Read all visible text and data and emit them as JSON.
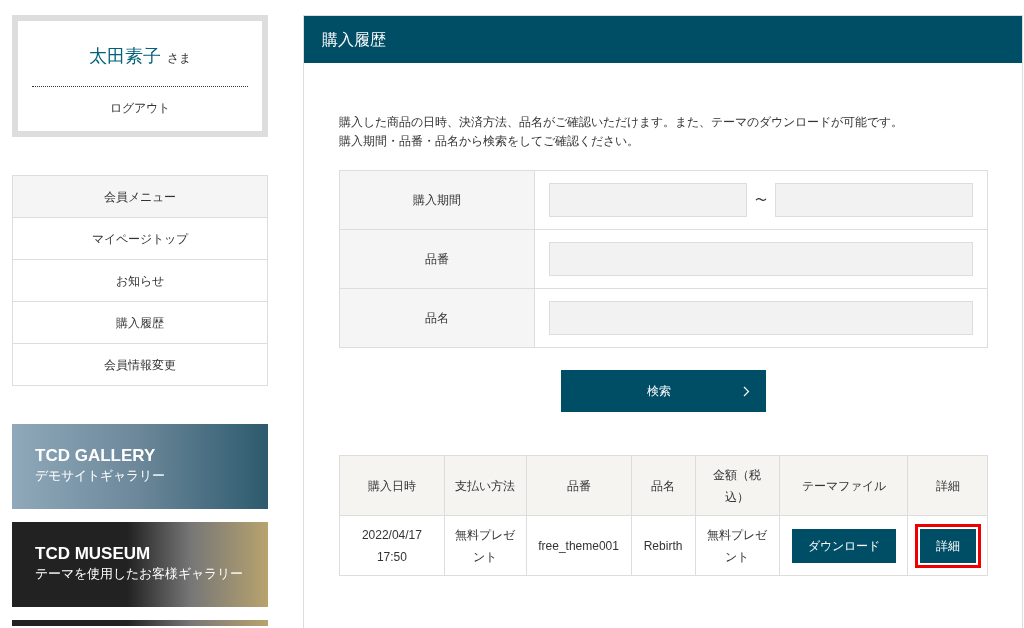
{
  "user_box": {
    "name": "太田素子",
    "honorific": "さま",
    "logout": "ログアウト"
  },
  "member_menu": {
    "heading": "会員メニュー",
    "items": [
      {
        "label": "マイページトップ"
      },
      {
        "label": "お知らせ"
      },
      {
        "label": "購入履歴"
      },
      {
        "label": "会員情報変更"
      }
    ]
  },
  "banners": [
    {
      "title": "TCD GALLERY",
      "subtitle": "デモサイトギャラリー",
      "kind": "light"
    },
    {
      "title": "TCD MUSEUM",
      "subtitle": "テーマを使用したお客様ギャラリー",
      "kind": "dark"
    },
    {
      "kind": "dark"
    }
  ],
  "panel": {
    "title": "購入履歴",
    "intro": [
      "購入した商品の日時、決済方法、品名がご確認いただけます。また、テーマのダウンロードが可能です。",
      "購入期間・品番・品名から検索をしてご確認ください。"
    ],
    "search_form": [
      {
        "label": "購入期間",
        "kind": "range",
        "separator": "〜"
      },
      {
        "label": "品番",
        "kind": "text"
      },
      {
        "label": "品名",
        "kind": "text"
      }
    ],
    "search_button": "検索",
    "results": {
      "columns": [
        "購入日時",
        "支払い方法",
        "品番",
        "品名",
        "金額（税込）",
        "テーマファイル",
        "詳細"
      ],
      "rows": [
        {
          "date": "2022/04/17 17:50",
          "payment": "無料プレゼント",
          "code": "free_theme001",
          "name": "Rebirth",
          "price": "無料プレゼント",
          "download": "ダウンロード",
          "detail": "詳細",
          "detail_highlighted": true
        }
      ]
    }
  }
}
